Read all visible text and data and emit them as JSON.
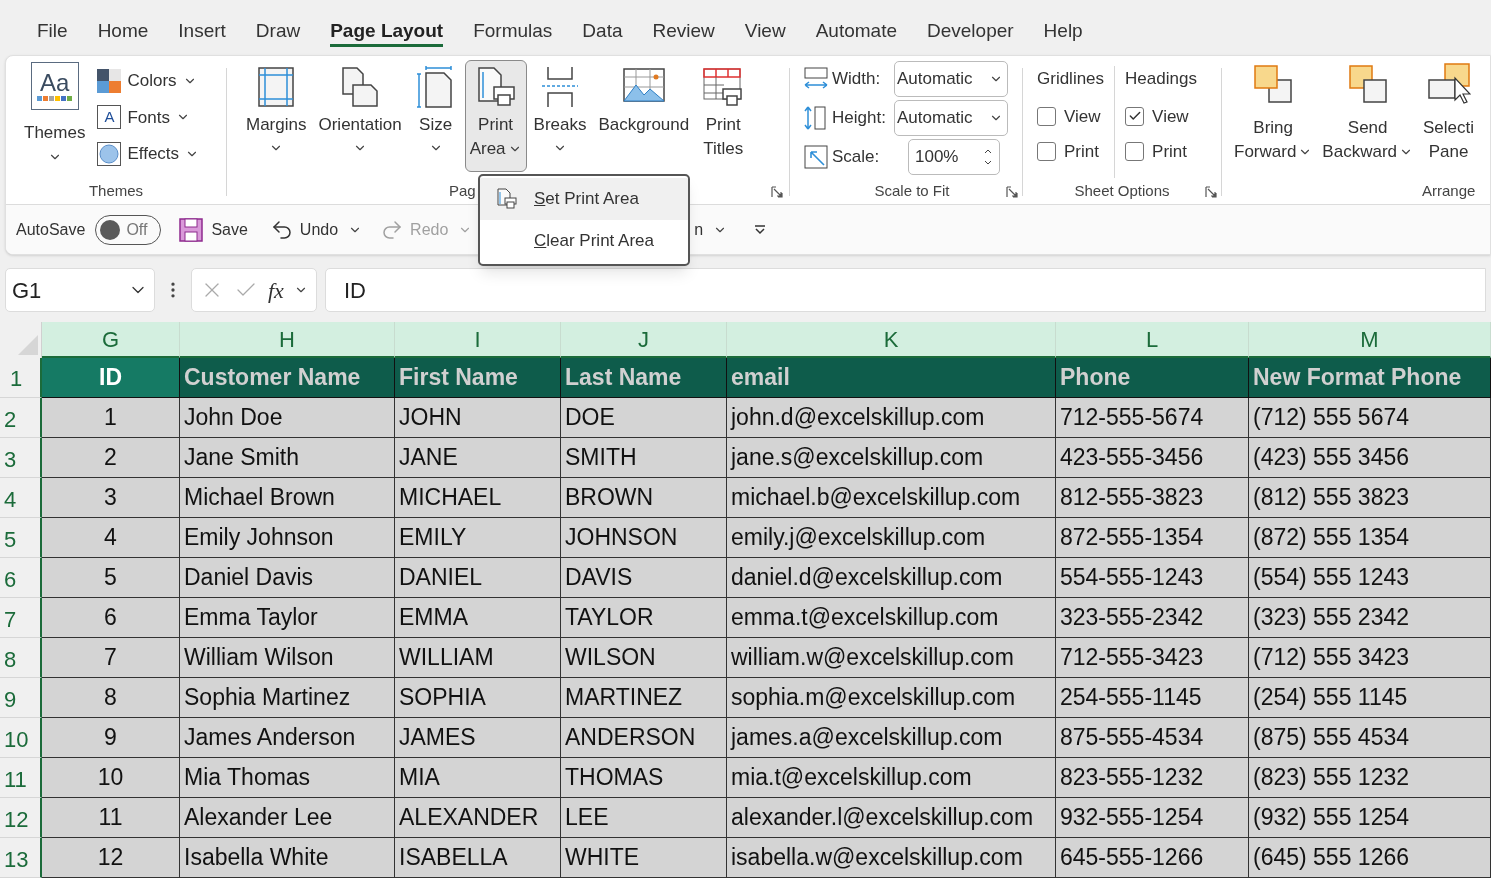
{
  "menu_tabs": [
    {
      "label": "File",
      "selected": false
    },
    {
      "label": "Home",
      "selected": false
    },
    {
      "label": "Insert",
      "selected": false
    },
    {
      "label": "Draw",
      "selected": false
    },
    {
      "label": "Page Layout",
      "selected": true
    },
    {
      "label": "Formulas",
      "selected": false
    },
    {
      "label": "Data",
      "selected": false
    },
    {
      "label": "Review",
      "selected": false
    },
    {
      "label": "View",
      "selected": false
    },
    {
      "label": "Automate",
      "selected": false
    },
    {
      "label": "Developer",
      "selected": false
    },
    {
      "label": "Help",
      "selected": false
    }
  ],
  "ribbon": {
    "themes": {
      "big": {
        "label": "Themes",
        "icon_text": "Aa"
      },
      "small": [
        {
          "label": "Colors",
          "kind": "colors"
        },
        {
          "label": "Fonts",
          "kind": "fonts",
          "icon_text": "A"
        },
        {
          "label": "Effects",
          "kind": "effects"
        }
      ],
      "group_label": "Themes"
    },
    "page_setup": {
      "buttons": [
        {
          "lines": [
            "Margins"
          ],
          "kind": "margins",
          "caret": true,
          "selected": false
        },
        {
          "lines": [
            "Orientation"
          ],
          "kind": "orientation",
          "caret": true,
          "selected": false
        },
        {
          "lines": [
            "Size"
          ],
          "kind": "size",
          "caret": true,
          "selected": false
        },
        {
          "lines": [
            "Print",
            "Area"
          ],
          "kind": "printarea",
          "caret": true,
          "selected": true
        },
        {
          "lines": [
            "Breaks"
          ],
          "kind": "breaks",
          "caret": true,
          "selected": false
        },
        {
          "lines": [
            "Background"
          ],
          "kind": "background",
          "caret": false,
          "selected": false
        },
        {
          "lines": [
            "Print",
            "Titles"
          ],
          "kind": "titles",
          "caret": false,
          "selected": false
        }
      ],
      "group_label": "Pag"
    },
    "scale_to_fit": {
      "width": {
        "label": "Width:",
        "value": "Automatic"
      },
      "height": {
        "label": "Height:",
        "value": "Automatic"
      },
      "scale": {
        "label": "Scale:",
        "value": "100%"
      },
      "group_label": "Scale to Fit"
    },
    "sheet_options": {
      "columns": [
        {
          "title": "Gridlines",
          "view": {
            "label": "View",
            "checked": false
          },
          "print": {
            "label": "Print",
            "checked": false
          }
        },
        {
          "title": "Headings",
          "view": {
            "label": "View",
            "checked": true
          },
          "print": {
            "label": "Print",
            "checked": false
          }
        }
      ],
      "group_label": "Sheet Options"
    },
    "arrange": {
      "buttons": [
        {
          "lines": [
            "Bring",
            "Forward"
          ],
          "kind": "forward",
          "caret": true
        },
        {
          "lines": [
            "Send",
            "Backward"
          ],
          "kind": "backward",
          "caret": true
        },
        {
          "lines": [
            "Selecti",
            "Pane"
          ],
          "kind": "selection",
          "caret": false
        }
      ],
      "group_label": "Arrange"
    }
  },
  "quick_access": {
    "autosave": {
      "label": "AutoSave",
      "on": false,
      "state_text": "Off"
    },
    "save": "Save",
    "undo": "Undo",
    "redo": {
      "label": "Redo",
      "disabled": true
    },
    "hidden_text": "n"
  },
  "print_area_menu": [
    {
      "underline": "S",
      "rest": "et Print Area",
      "hovered": true
    },
    {
      "underline": "C",
      "rest": "lear Print Area",
      "hovered": false
    }
  ],
  "formula_bar": {
    "name_box": "G1",
    "fx": "fx",
    "value": "ID"
  },
  "sheet": {
    "columns": [
      "G",
      "H",
      "I",
      "J",
      "K",
      "L",
      "M"
    ],
    "header_row": {
      "number": "1",
      "cells": [
        {
          "text": "ID",
          "selected": true
        },
        {
          "text": "Customer Name",
          "selected": false
        },
        {
          "text": "First Name",
          "selected": false
        },
        {
          "text": "Last Name",
          "selected": false
        },
        {
          "text": "email",
          "selected": false
        },
        {
          "text": "Phone",
          "selected": false
        },
        {
          "text": "New Format Phone",
          "selected": false
        }
      ]
    },
    "rows": [
      {
        "number": "2",
        "cells": [
          "1",
          "John Doe",
          "JOHN",
          "DOE",
          "john.d@excelskillup.com",
          "712-555-5674",
          "(712) 555 5674"
        ]
      },
      {
        "number": "3",
        "cells": [
          "2",
          "Jane Smith",
          "JANE",
          "SMITH",
          "jane.s@excelskillup.com",
          "423-555-3456",
          "(423) 555 3456"
        ]
      },
      {
        "number": "4",
        "cells": [
          "3",
          "Michael Brown",
          "MICHAEL",
          "BROWN",
          "michael.b@excelskillup.com",
          "812-555-3823",
          "(812) 555 3823"
        ]
      },
      {
        "number": "5",
        "cells": [
          "4",
          "Emily Johnson",
          "EMILY",
          "JOHNSON",
          "emily.j@excelskillup.com",
          "872-555-1354",
          "(872) 555 1354"
        ]
      },
      {
        "number": "6",
        "cells": [
          "5",
          "Daniel Davis",
          "DANIEL",
          "DAVIS",
          "daniel.d@excelskillup.com",
          "554-555-1243",
          "(554) 555 1243"
        ]
      },
      {
        "number": "7",
        "cells": [
          "6",
          "Emma Taylor",
          "EMMA",
          "TAYLOR",
          "emma.t@excelskillup.com",
          "323-555-2342",
          "(323) 555 2342"
        ]
      },
      {
        "number": "8",
        "cells": [
          "7",
          "William Wilson",
          "WILLIAM",
          "WILSON",
          "william.w@excelskillup.com",
          "712-555-3423",
          "(712) 555 3423"
        ]
      },
      {
        "number": "9",
        "cells": [
          "8",
          "Sophia Martinez",
          "SOPHIA",
          "MARTINEZ",
          "sophia.m@excelskillup.com",
          "254-555-1145",
          "(254) 555 1145"
        ]
      },
      {
        "number": "10",
        "cells": [
          "9",
          "James Anderson",
          "JAMES",
          "ANDERSON",
          "james.a@excelskillup.com",
          "875-555-4534",
          "(875) 555 4534"
        ]
      },
      {
        "number": "11",
        "cells": [
          "10",
          "Mia Thomas",
          "MIA",
          "THOMAS",
          "mia.t@excelskillup.com",
          "823-555-1232",
          "(823) 555 1232"
        ]
      },
      {
        "number": "12",
        "cells": [
          "11",
          "Alexander Lee",
          "ALEXANDER",
          "LEE",
          "alexander.l@excelskillup.com",
          "932-555-1254",
          "(932) 555 1254"
        ]
      },
      {
        "number": "13",
        "cells": [
          "12",
          "Isabella White",
          "ISABELLA",
          "WHITE",
          "isabella.w@excelskillup.com",
          "645-555-1266",
          "(645) 555 1266"
        ]
      }
    ]
  }
}
